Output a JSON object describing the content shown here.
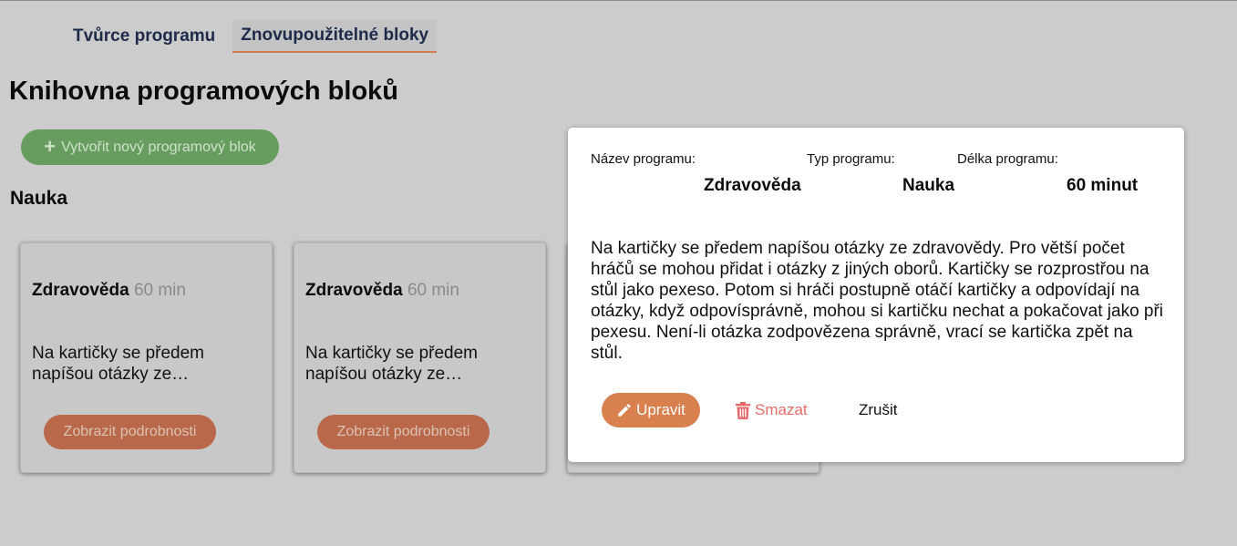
{
  "tabs": [
    {
      "label": "Tvůrce programu",
      "active": false
    },
    {
      "label": "Znovupoužitelné bloky",
      "active": true
    }
  ],
  "page_title": "Knihovna programových bloků",
  "create_button": {
    "label": "Vytvořit nový programový blok",
    "icon": "plus-icon"
  },
  "section_title": "Nauka",
  "cards": [
    {
      "name": "Zdravověda",
      "duration": "60 min",
      "description": "Na kartičky se předem napíšou otázky ze…",
      "button": "Zobrazit podrobnosti"
    },
    {
      "name": "Zdravověda",
      "duration": "60 min",
      "description": "Na kartičky se předem napíšou otázky ze…",
      "button": "Zobrazit podrobnosti"
    }
  ],
  "modal": {
    "name_label": "Název programu:",
    "type_label": "Typ programu:",
    "length_label": "Délka programu:",
    "name_value": "Zdravověda",
    "type_value": "Nauka",
    "length_value": "60 minut",
    "description": "Na kartičky se předem napíšou otázky ze zdravovědy. Pro větší počet hráčů se mohou přidat i otázky z jiných oborů. Kartičky se rozprostřou na stůl jako pexeso. Potom si hráči postupně otáčí kartičky a odpovídají na otázky, když odpovísprávně, mohou si kartičku nechat a pokačovat jako při pexesu. Není-li otázka zodpovězena správně, vrací se kartička zpět na stůl.",
    "edit_label": "Upravit",
    "edit_icon": "pencil-icon",
    "delete_label": "Smazat",
    "delete_icon": "trash-icon",
    "cancel_label": "Zrušit"
  },
  "colors": {
    "background": "#cccccc",
    "tab_text": "#1e2a4a",
    "tab_underline": "#d07a4d",
    "create_button": "#679e60",
    "card_button": "#b9694a",
    "edit_button": "#d9804f",
    "delete_text": "#e86a6a"
  }
}
